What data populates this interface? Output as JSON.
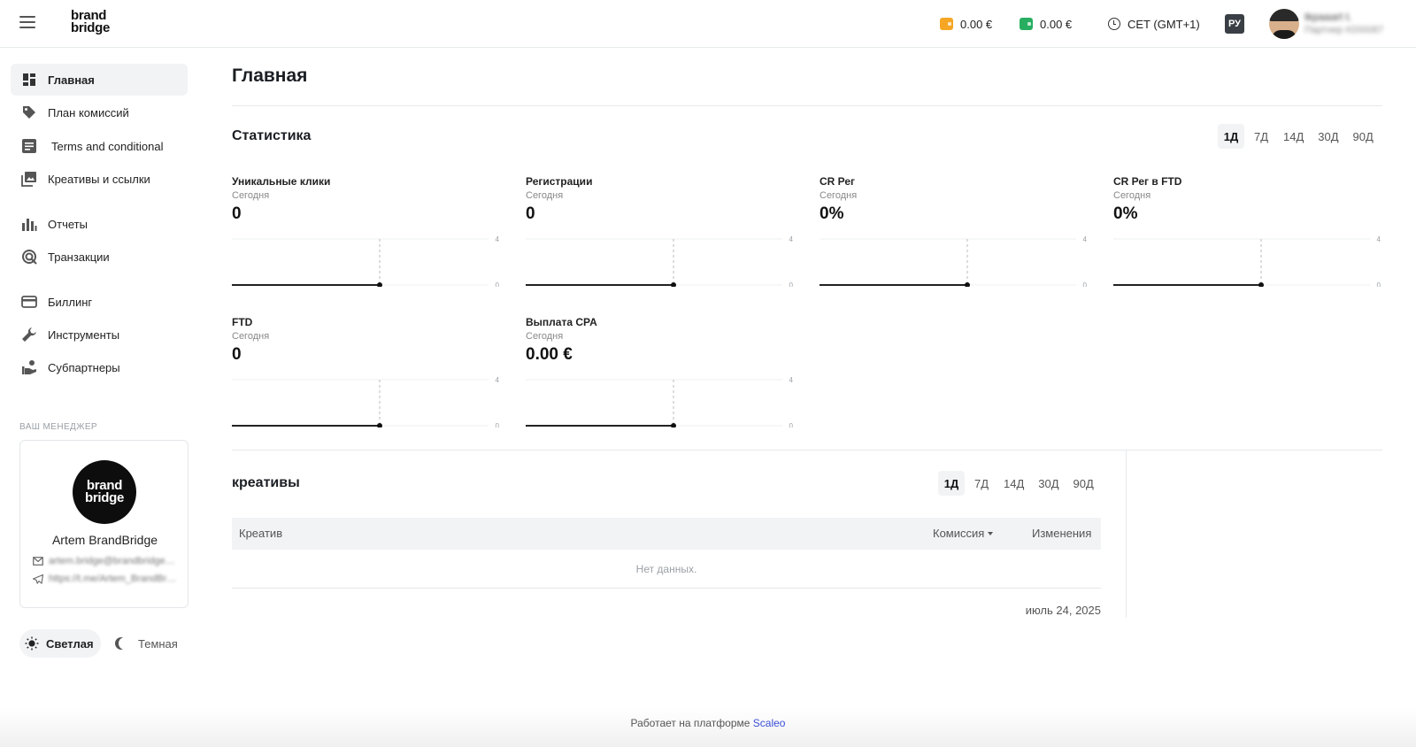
{
  "header": {
    "logo_line1": "brand",
    "logo_line2": "bridge",
    "balance1": "0.00 €",
    "balance2": "0.00 €",
    "timezone": "CET (GMT+1)",
    "language": "РУ",
    "user_name": "tkpaaart t.",
    "user_sub": "Партнер #200087",
    "colors": {
      "wallet1": "#f5a623",
      "wallet2": "#27ae60"
    }
  },
  "sidebar": {
    "items": [
      {
        "label": "Главная",
        "icon": "dashboard-icon",
        "active": true
      },
      {
        "label": "План комиссий",
        "icon": "tag-icon"
      },
      {
        "label": "Terms and conditional",
        "icon": "document-icon"
      },
      {
        "label": "Креативы и ссылки",
        "icon": "images-icon"
      },
      {
        "label": "Отчеты",
        "icon": "bar-chart-icon"
      },
      {
        "label": "Транзакции",
        "icon": "transactions-icon"
      },
      {
        "label": "Биллинг",
        "icon": "credit-card-icon"
      },
      {
        "label": "Инструменты",
        "icon": "wrench-icon"
      },
      {
        "label": "Субпартнеры",
        "icon": "subpartners-icon"
      }
    ],
    "manager_caption": "ВАШ МЕНЕДЖЕР",
    "manager": {
      "logo_line1": "brand",
      "logo_line2": "bridge",
      "name": "Artem BrandBridge",
      "email": "artem.bridge@brandbridge.com",
      "telegram": "https://t.me/Artem_BrandBridge"
    },
    "theme": {
      "light": "Светлая",
      "dark": "Темная"
    }
  },
  "main": {
    "title": "Главная",
    "stats": {
      "title": "Статистика",
      "periods": [
        "1Д",
        "7Д",
        "14Д",
        "30Д",
        "90Д"
      ],
      "active_period": "1Д",
      "kpis": [
        {
          "label": "Уникальные клики",
          "sub": "Сегодня",
          "value": "0",
          "y_max": "4",
          "y_min": "0"
        },
        {
          "label": "Регистрации",
          "sub": "Сегодня",
          "value": "0",
          "y_max": "4",
          "y_min": "0"
        },
        {
          "label": "CR Рег",
          "sub": "Сегодня",
          "value": "0%",
          "y_max": "4",
          "y_min": "0"
        },
        {
          "label": "CR Рег в FTD",
          "sub": "Сегодня",
          "value": "0%",
          "y_max": "4",
          "y_min": "0"
        },
        {
          "label": "FTD",
          "sub": "Сегодня",
          "value": "0",
          "y_max": "4",
          "y_min": "0"
        },
        {
          "label": "Выплата CPA",
          "sub": "Сегодня",
          "value": "0.00 €",
          "y_max": "4",
          "y_min": "0"
        }
      ]
    },
    "creatives": {
      "title": "креативы",
      "periods": [
        "1Д",
        "7Д",
        "14Д",
        "30Д",
        "90Д"
      ],
      "active_period": "1Д",
      "columns": {
        "creative": "Креатив",
        "commission": "Комиссия",
        "changes": "Изменения"
      },
      "empty": "Нет данных.",
      "date": "июль 24, 2025"
    }
  },
  "footer": {
    "text": "Работает на платформе ",
    "link": "Scaleo"
  }
}
